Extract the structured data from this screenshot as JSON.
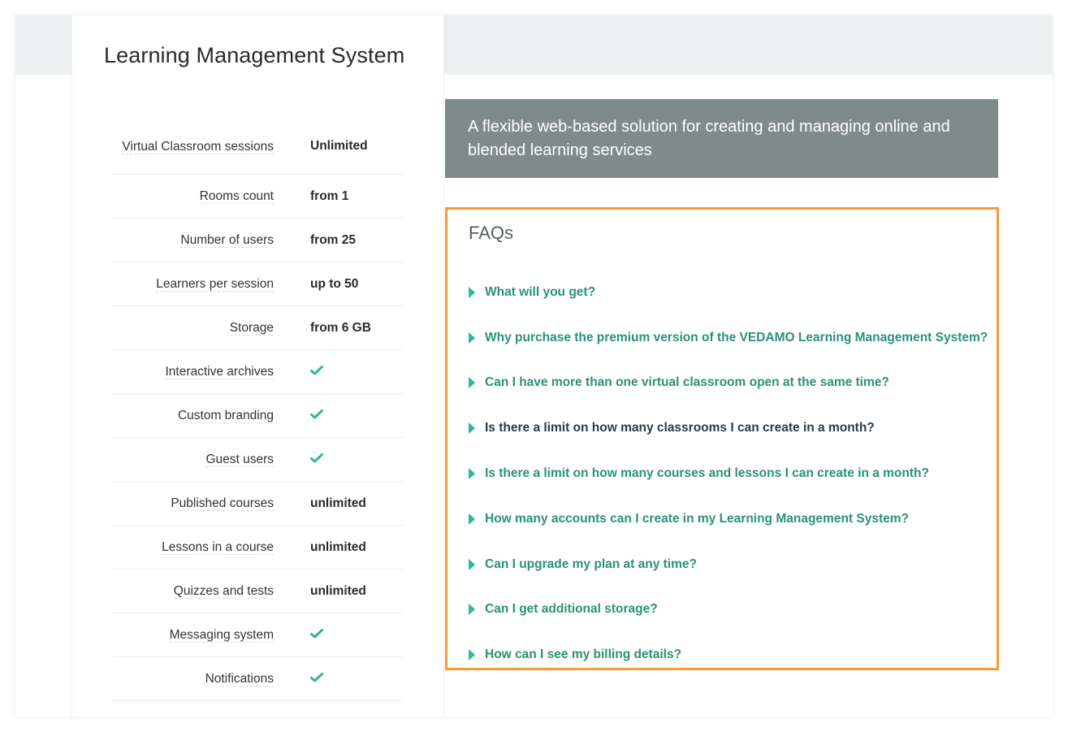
{
  "plan": {
    "title": "Learning Management System",
    "features": [
      {
        "label": "Virtual Classroom sessions",
        "value": "Unlimited",
        "type": "text"
      },
      {
        "label": "Rooms count",
        "value": "from 1",
        "type": "text"
      },
      {
        "label": "Number of users",
        "value": "from 25",
        "type": "text"
      },
      {
        "label": "Learners per session",
        "value": "up to 50",
        "type": "text"
      },
      {
        "label": "Storage",
        "value": "from 6 GB",
        "type": "text"
      },
      {
        "label": "Interactive archives",
        "value": "check-icon",
        "type": "check"
      },
      {
        "label": "Custom branding",
        "value": "check-icon",
        "type": "check"
      },
      {
        "label": "Guest users",
        "value": "check-icon",
        "type": "check"
      },
      {
        "label": "Published courses",
        "value": "unlimited",
        "type": "text"
      },
      {
        "label": "Lessons in a course",
        "value": "unlimited",
        "type": "text"
      },
      {
        "label": "Quizzes and tests",
        "value": "unlimited",
        "type": "text"
      },
      {
        "label": "Messaging system",
        "value": "check-icon",
        "type": "check"
      },
      {
        "label": "Notifications",
        "value": "check-icon",
        "type": "check"
      }
    ]
  },
  "banner": {
    "text": "A flexible web-based solution for creating and managing online and blended learning services"
  },
  "faq": {
    "title": "FAQs",
    "items": [
      {
        "question": "What will you get?",
        "state": "normal"
      },
      {
        "question": "Why purchase the premium version of the VEDAMO Learning Management System?",
        "state": "normal"
      },
      {
        "question": "Can I have more than one virtual classroom open at the same time?",
        "state": "normal"
      },
      {
        "question": "Is there a limit on how many classrooms I can create in a month?",
        "state": "hover"
      },
      {
        "question": "Is there a limit on how many courses and lessons I can create in a month?",
        "state": "normal"
      },
      {
        "question": "How many accounts can I create in my Learning Management System?",
        "state": "normal"
      },
      {
        "question": "Can I upgrade my plan at any time?",
        "state": "normal"
      },
      {
        "question": "Can I get additional storage?",
        "state": "normal"
      },
      {
        "question": "How can I see my billing details?",
        "state": "normal"
      }
    ]
  },
  "colors": {
    "accent": "#2a9178",
    "check": "#2fb79b",
    "highlight_border": "#fa9a36",
    "banner_bg": "#7f8b8a",
    "hover_text": "#2b3a4a"
  }
}
